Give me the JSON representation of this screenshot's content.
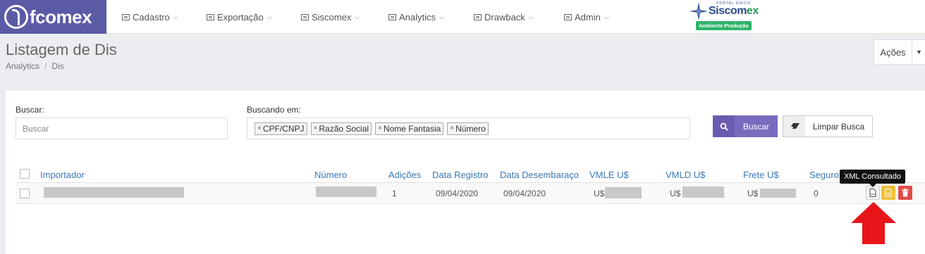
{
  "brand": {
    "name": "fcomex"
  },
  "nav": [
    {
      "label": "Cadastro"
    },
    {
      "label": "Exportação"
    },
    {
      "label": "Siscomex"
    },
    {
      "label": "Analytics"
    },
    {
      "label": "Drawback"
    },
    {
      "label": "Admin"
    }
  ],
  "siscomex": {
    "portal": "PORTAL ÚNICO",
    "name_a": "Siscom",
    "name_b": "ex",
    "env": "Ambiente Produção"
  },
  "page": {
    "title": "Listagem de Dis",
    "breadcrumb": [
      "Analytics",
      "Dis"
    ],
    "actions_label": "Ações"
  },
  "search": {
    "label": "Buscar:",
    "placeholder": "Buscar",
    "fields_label": "Buscando em:",
    "tags": [
      "CPF/CNPJ",
      "Razão Social",
      "Nome Fantasia",
      "Número"
    ],
    "search_button": "Buscar",
    "clear_button": "Limpar Busca"
  },
  "table": {
    "columns": [
      "Importador",
      "Número",
      "Adições",
      "Data Registro",
      "Data Desembaraço",
      "VMLE U$",
      "VMLD U$",
      "Frete U$",
      "Seguro"
    ],
    "rows": [
      {
        "adicoes": "1",
        "data_registro": "09/04/2020",
        "data_desembaraco": "09/04/2020",
        "vmle_prefix": "U$",
        "vmld_prefix": "U$",
        "frete_prefix": "U$",
        "seguro": "0"
      }
    ],
    "tooltip": "XML Consultado"
  },
  "colors": {
    "brand": "#5b5aa5",
    "primary": "#7a6bbf",
    "link": "#3a78b5",
    "warning": "#f0c039",
    "danger": "#e04b4b",
    "env_badge": "#2fb36a",
    "annotation_arrow": "#e8161b"
  }
}
